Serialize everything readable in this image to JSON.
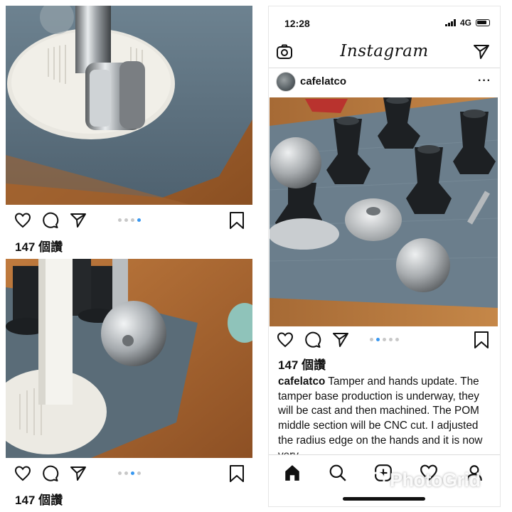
{
  "left_posts": [
    {
      "likes": "147 個讚",
      "active_dot": 3,
      "dot_count": 4
    },
    {
      "likes": "147 個讚",
      "active_dot": 2,
      "dot_count": 4
    }
  ],
  "phone": {
    "status": {
      "time": "12:28",
      "network": "4G"
    },
    "app_logo": "Instagram",
    "post": {
      "username": "cafelatco",
      "more": "···",
      "likes": "147 個讚",
      "active_dot": 2,
      "dot_count": 5,
      "caption_user": "cafelatco",
      "caption_text": " Tamper and hands update. The tamper base production is underway, they will be cast and then machined. The POM middle section will be CNC cut.  I adjusted the radius edge on the hands and it is now very"
    },
    "tabs": [
      "home-icon",
      "search-icon",
      "add-post-icon",
      "heart-icon",
      "profile-icon"
    ]
  },
  "watermark": "PhotoGrid",
  "icons": [
    "heart-icon",
    "comment-icon",
    "send-icon",
    "bookmark-icon",
    "camera-icon",
    "direct-icon"
  ]
}
